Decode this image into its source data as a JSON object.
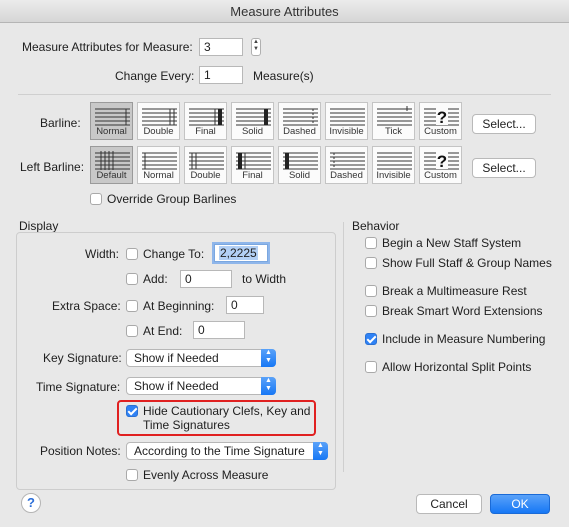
{
  "window": {
    "title": "Measure Attributes"
  },
  "measure": {
    "label": "Measure Attributes for Measure:",
    "value": "3",
    "change_every_label": "Change Every:",
    "change_every_value": "1",
    "units_label": "Measure(s)"
  },
  "barline": {
    "label": "Barline:",
    "options": [
      "Normal",
      "Double",
      "Final",
      "Solid",
      "Dashed",
      "Invisible",
      "Tick",
      "Custom"
    ],
    "selected": "Normal",
    "select_button": "Select..."
  },
  "left_barline": {
    "label": "Left Barline:",
    "options": [
      "Default",
      "Normal",
      "Double",
      "Final",
      "Solid",
      "Dashed",
      "Invisible",
      "Custom"
    ],
    "selected": "Default",
    "select_button": "Select..."
  },
  "override_group_barlines": {
    "label": "Override Group Barlines",
    "checked": false
  },
  "display": {
    "title": "Display",
    "width_label": "Width:",
    "change_to_label": "Change To:",
    "change_to_value": "2,2225",
    "add_label": "Add:",
    "add_value": "0",
    "to_width_label": "to Width",
    "extra_space_label": "Extra Space:",
    "at_beginning_label": "At Beginning:",
    "at_beginning_value": "0",
    "at_end_label": "At End:",
    "at_end_value": "0",
    "key_signature_label": "Key Signature:",
    "key_signature_value": "Show if Needed",
    "time_signature_label": "Time Signature:",
    "time_signature_value": "Show if Needed",
    "hide_cautionary_line1": "Hide Cautionary Clefs, Key and",
    "hide_cautionary_line2": "Time Signatures",
    "hide_cautionary_checked": true,
    "position_notes_label": "Position Notes:",
    "position_notes_value": "According to the Time Signature",
    "evenly_label": "Evenly Across Measure"
  },
  "behavior": {
    "title": "Behavior",
    "items": [
      {
        "label": "Begin a New Staff System",
        "checked": false
      },
      {
        "label": "Show Full Staff & Group Names",
        "checked": false
      },
      {
        "label": "Break a Multimeasure Rest",
        "checked": false
      },
      {
        "label": "Break Smart Word Extensions",
        "checked": false
      },
      {
        "label": "Include in Measure Numbering",
        "checked": true
      },
      {
        "label": "Allow Horizontal Split Points",
        "checked": false
      }
    ]
  },
  "footer": {
    "help": "?",
    "cancel": "Cancel",
    "ok": "OK"
  },
  "colors": {
    "accent": "#1677f5",
    "highlight_box": "#e02020"
  }
}
